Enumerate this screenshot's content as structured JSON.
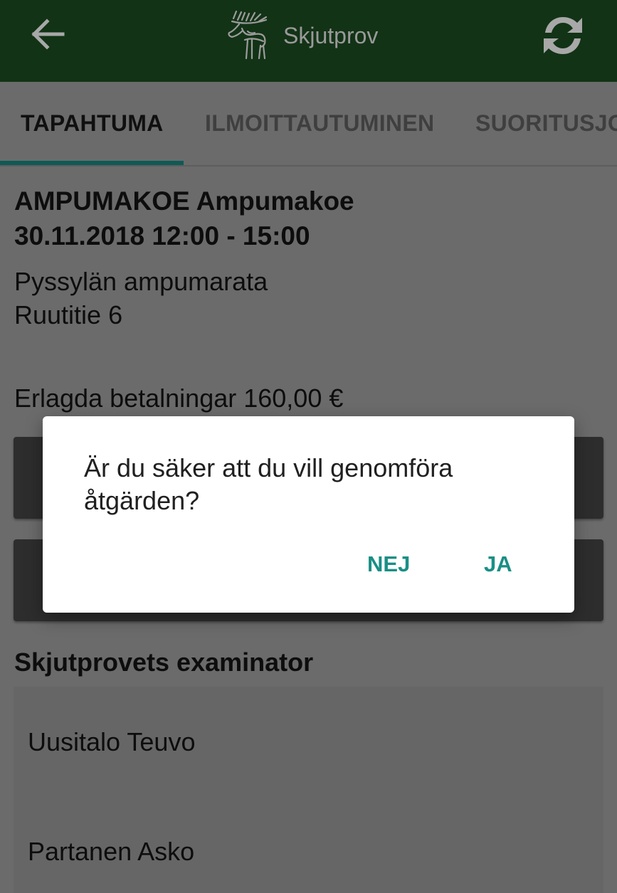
{
  "appbar": {
    "title": "Skjutprov",
    "back_icon": "arrow-back-icon",
    "logo_icon": "moose-logo-icon",
    "refresh_icon": "refresh-icon"
  },
  "tabs": [
    {
      "label": "TAPAHTUMA",
      "active": true
    },
    {
      "label": "ILMOITTAUTUMINEN",
      "active": false
    },
    {
      "label": "SUORITUSJO",
      "active": false
    }
  ],
  "event": {
    "title_line1": "AMPUMAKOE Ampumakoe",
    "title_line2": "30.11.2018 12:00 - 15:00",
    "place_line1": "Pyssylän ampumarata",
    "place_line2": "Ruutitie 6",
    "payments": "Erlagda betalningar 160,00 €"
  },
  "examiners": {
    "heading": "Skjutprovets examinator",
    "names": [
      "Uusitalo Teuvo",
      "Partanen Asko"
    ]
  },
  "dialog": {
    "message": "Är du säker att du vill genomföra åtgärden?",
    "no_label": "NEJ",
    "yes_label": "JA"
  },
  "colors": {
    "appbar": "#123316",
    "accent": "#1a8f85",
    "tab_indicator": "#0f5a55",
    "scrim_background": "#6b6b6b"
  }
}
